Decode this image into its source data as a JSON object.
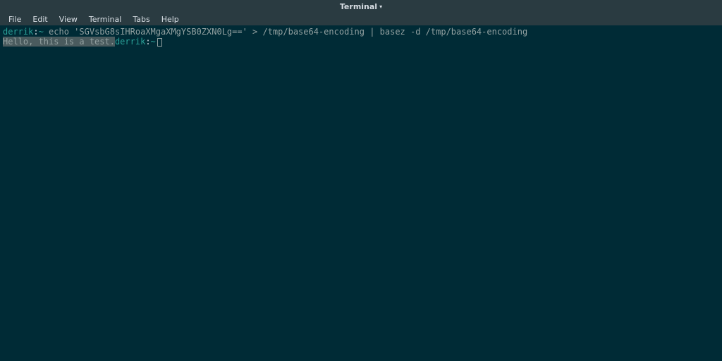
{
  "title": "Terminal",
  "menu": {
    "file": "File",
    "edit": "Edit",
    "view": "View",
    "terminal": "Terminal",
    "tabs": "Tabs",
    "help": "Help"
  },
  "line1": {
    "user": "derrik",
    "sep": ":",
    "path": "~",
    "command": " echo 'SGVsbG8sIHRoaXMgaXMgYSB0ZXN0Lg==' > /tmp/base64-encoding | basez -d /tmp/base64-encoding"
  },
  "line2": {
    "output": "Hello, this is a test.",
    "user": "derrik",
    "sep": ":",
    "path": "~"
  }
}
